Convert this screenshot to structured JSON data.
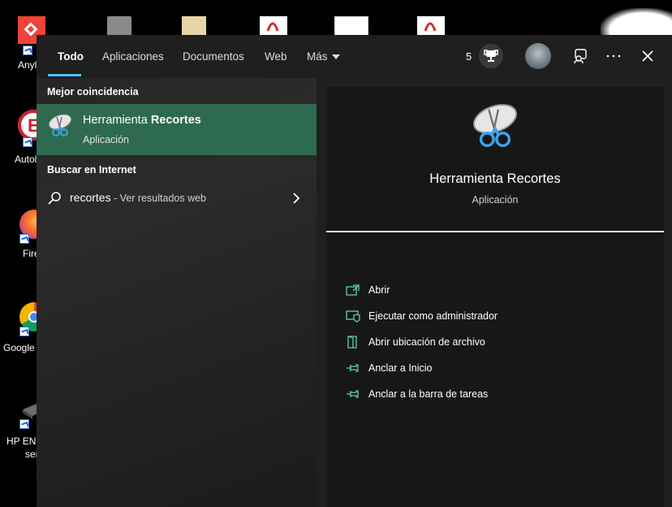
{
  "desktop": {
    "icons": [
      {
        "label": "Anyl"
      },
      {
        "label": "Autol"
      },
      {
        "label": "Fire"
      },
      {
        "label": "Google"
      },
      {
        "label": "HP ENV"
      },
      {
        "label": "ser"
      }
    ]
  },
  "tabs": [
    {
      "label": "Todo"
    },
    {
      "label": "Aplicaciones"
    },
    {
      "label": "Documentos"
    },
    {
      "label": "Web"
    },
    {
      "label": "Más"
    }
  ],
  "header": {
    "rewards_count": "5"
  },
  "left": {
    "best_match_title": "Mejor coincidencia",
    "best_match": {
      "name_prefix": "Herramienta ",
      "name_match": "Recortes",
      "type": "Aplicación"
    },
    "web_title": "Buscar en Internet",
    "web_query": "recortes",
    "web_suffix": " - Ver resultados web"
  },
  "detail": {
    "name": "Herramienta Recortes",
    "type": "Aplicación",
    "actions": [
      {
        "label": "Abrir",
        "icon": "open-icon"
      },
      {
        "label": "Ejecutar como administrador",
        "icon": "shield-icon"
      },
      {
        "label": "Abrir ubicación de archivo",
        "icon": "file-location-icon"
      },
      {
        "label": "Anclar a Inicio",
        "icon": "pin-icon"
      },
      {
        "label": "Anclar a la barra de tareas",
        "icon": "pin-icon"
      }
    ]
  },
  "colors": {
    "accent": "#4cc2ff",
    "selection": "#2e6a4f",
    "action_icon": "#5fd3a8"
  }
}
